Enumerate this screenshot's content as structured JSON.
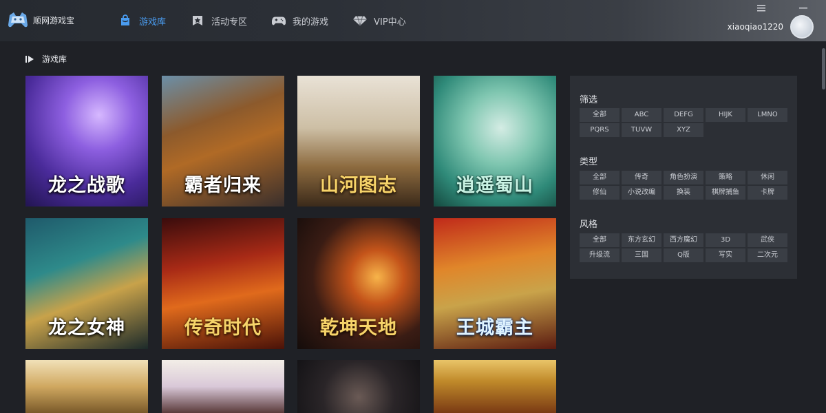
{
  "app": {
    "title": "顺网游戏宝"
  },
  "nav": [
    {
      "label": "游戏库",
      "icon": "bag-icon",
      "active": true
    },
    {
      "label": "活动专区",
      "icon": "star-badge-icon",
      "active": false
    },
    {
      "label": "我的游戏",
      "icon": "gamepad-icon",
      "active": false
    },
    {
      "label": "VIP中心",
      "icon": "diamond-icon",
      "active": false
    }
  ],
  "window_controls": [
    "menu-icon",
    "minimize-icon"
  ],
  "user": {
    "name": "xiaoqiao1220"
  },
  "section": {
    "title": "游戏库"
  },
  "games": [
    {
      "name": "龙之战歌"
    },
    {
      "name": "霸者归来"
    },
    {
      "name": "山河图志"
    },
    {
      "name": "逍遥蜀山"
    },
    {
      "name": "龙之女神"
    },
    {
      "name": "传奇时代"
    },
    {
      "name": "乾坤天地"
    },
    {
      "name": "王城霸主"
    },
    {
      "name": ""
    },
    {
      "name": ""
    },
    {
      "name": ""
    },
    {
      "name": ""
    }
  ],
  "filters": {
    "groups": [
      {
        "label": "筛选",
        "options": [
          "全部",
          "ABC",
          "DEFG",
          "HIJK",
          "LMNO",
          "PQRS",
          "TUVW",
          "XYZ"
        ]
      },
      {
        "label": "类型",
        "options": [
          "全部",
          "传奇",
          "角色扮演",
          "策略",
          "休闲",
          "修仙",
          "小说改编",
          "换装",
          "棋牌捕鱼",
          "卡牌"
        ]
      },
      {
        "label": "风格",
        "options": [
          "全部",
          "东方玄幻",
          "西方魔幻",
          "3D",
          "武侠",
          "升级流",
          "三国",
          "Q版",
          "写实",
          "二次元"
        ]
      }
    ]
  },
  "colors": {
    "accent": "#4a9cf0",
    "background": "#1f2126",
    "panel": "#2c2f35",
    "chip": "#3a3e45"
  }
}
